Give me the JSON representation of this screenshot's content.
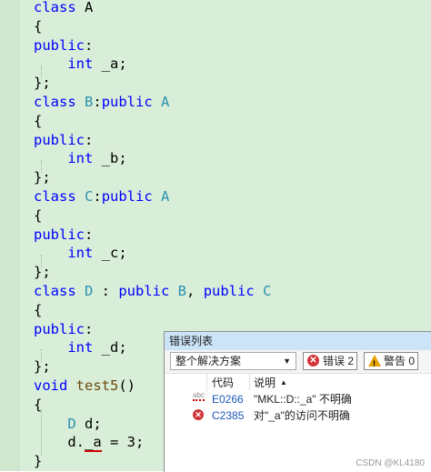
{
  "code_lines": [
    {
      "kw": "class",
      "rest": " A"
    },
    {
      "plain": "{"
    },
    {
      "kw": "public",
      "rest": ":"
    },
    {
      "indent": "    ",
      "kw": "int",
      "rest": " _a;"
    },
    {
      "plain": "};"
    },
    {
      "kw": "class",
      "ty1": " B",
      "mid": ":",
      "kw2": "public",
      "ty2": " A"
    },
    {
      "plain": "{"
    },
    {
      "kw": "public",
      "rest": ":"
    },
    {
      "indent": "    ",
      "kw": "int",
      "rest": " _b;"
    },
    {
      "plain": "};"
    },
    {
      "kw": "class",
      "ty1": " C",
      "mid": ":",
      "kw2": "public",
      "ty2": " A"
    },
    {
      "plain": "{"
    },
    {
      "kw": "public",
      "rest": ":"
    },
    {
      "indent": "    ",
      "kw": "int",
      "rest": " _c;"
    },
    {
      "plain": "};"
    },
    {
      "kw": "class",
      "ty1": " D",
      "mid": " : ",
      "kw2": "public",
      "ty2": " B",
      "mid2": ", ",
      "kw3": "public",
      "ty3": " C"
    },
    {
      "plain": "{"
    },
    {
      "kw": "public",
      "rest": ":"
    },
    {
      "indent": "    ",
      "kw": "int",
      "rest": " _d;"
    },
    {
      "plain": "};"
    },
    {
      "kw": "void",
      "fn": " test5",
      "rest": "()"
    },
    {
      "plain": "{"
    },
    {
      "indent": "    ",
      "ty1": "D",
      "rest": " d;"
    },
    {
      "indent": "    ",
      "pre": "d.",
      "err": "_a",
      "rest": " = 3;"
    },
    {
      "plain": "}"
    }
  ],
  "error_list": {
    "title": "错误列表",
    "scope": "整个解决方案",
    "error_filter": "错误 2",
    "warning_filter": "警告 0",
    "columns": {
      "code": "代码",
      "description": "说明"
    },
    "rows": [
      {
        "code": "E0266",
        "description": "\"MKL::D::_a\" 不明确"
      },
      {
        "code": "C2385",
        "description": "对\"_a\"的访问不明确"
      }
    ]
  },
  "watermark": "CSDN @KL4180"
}
